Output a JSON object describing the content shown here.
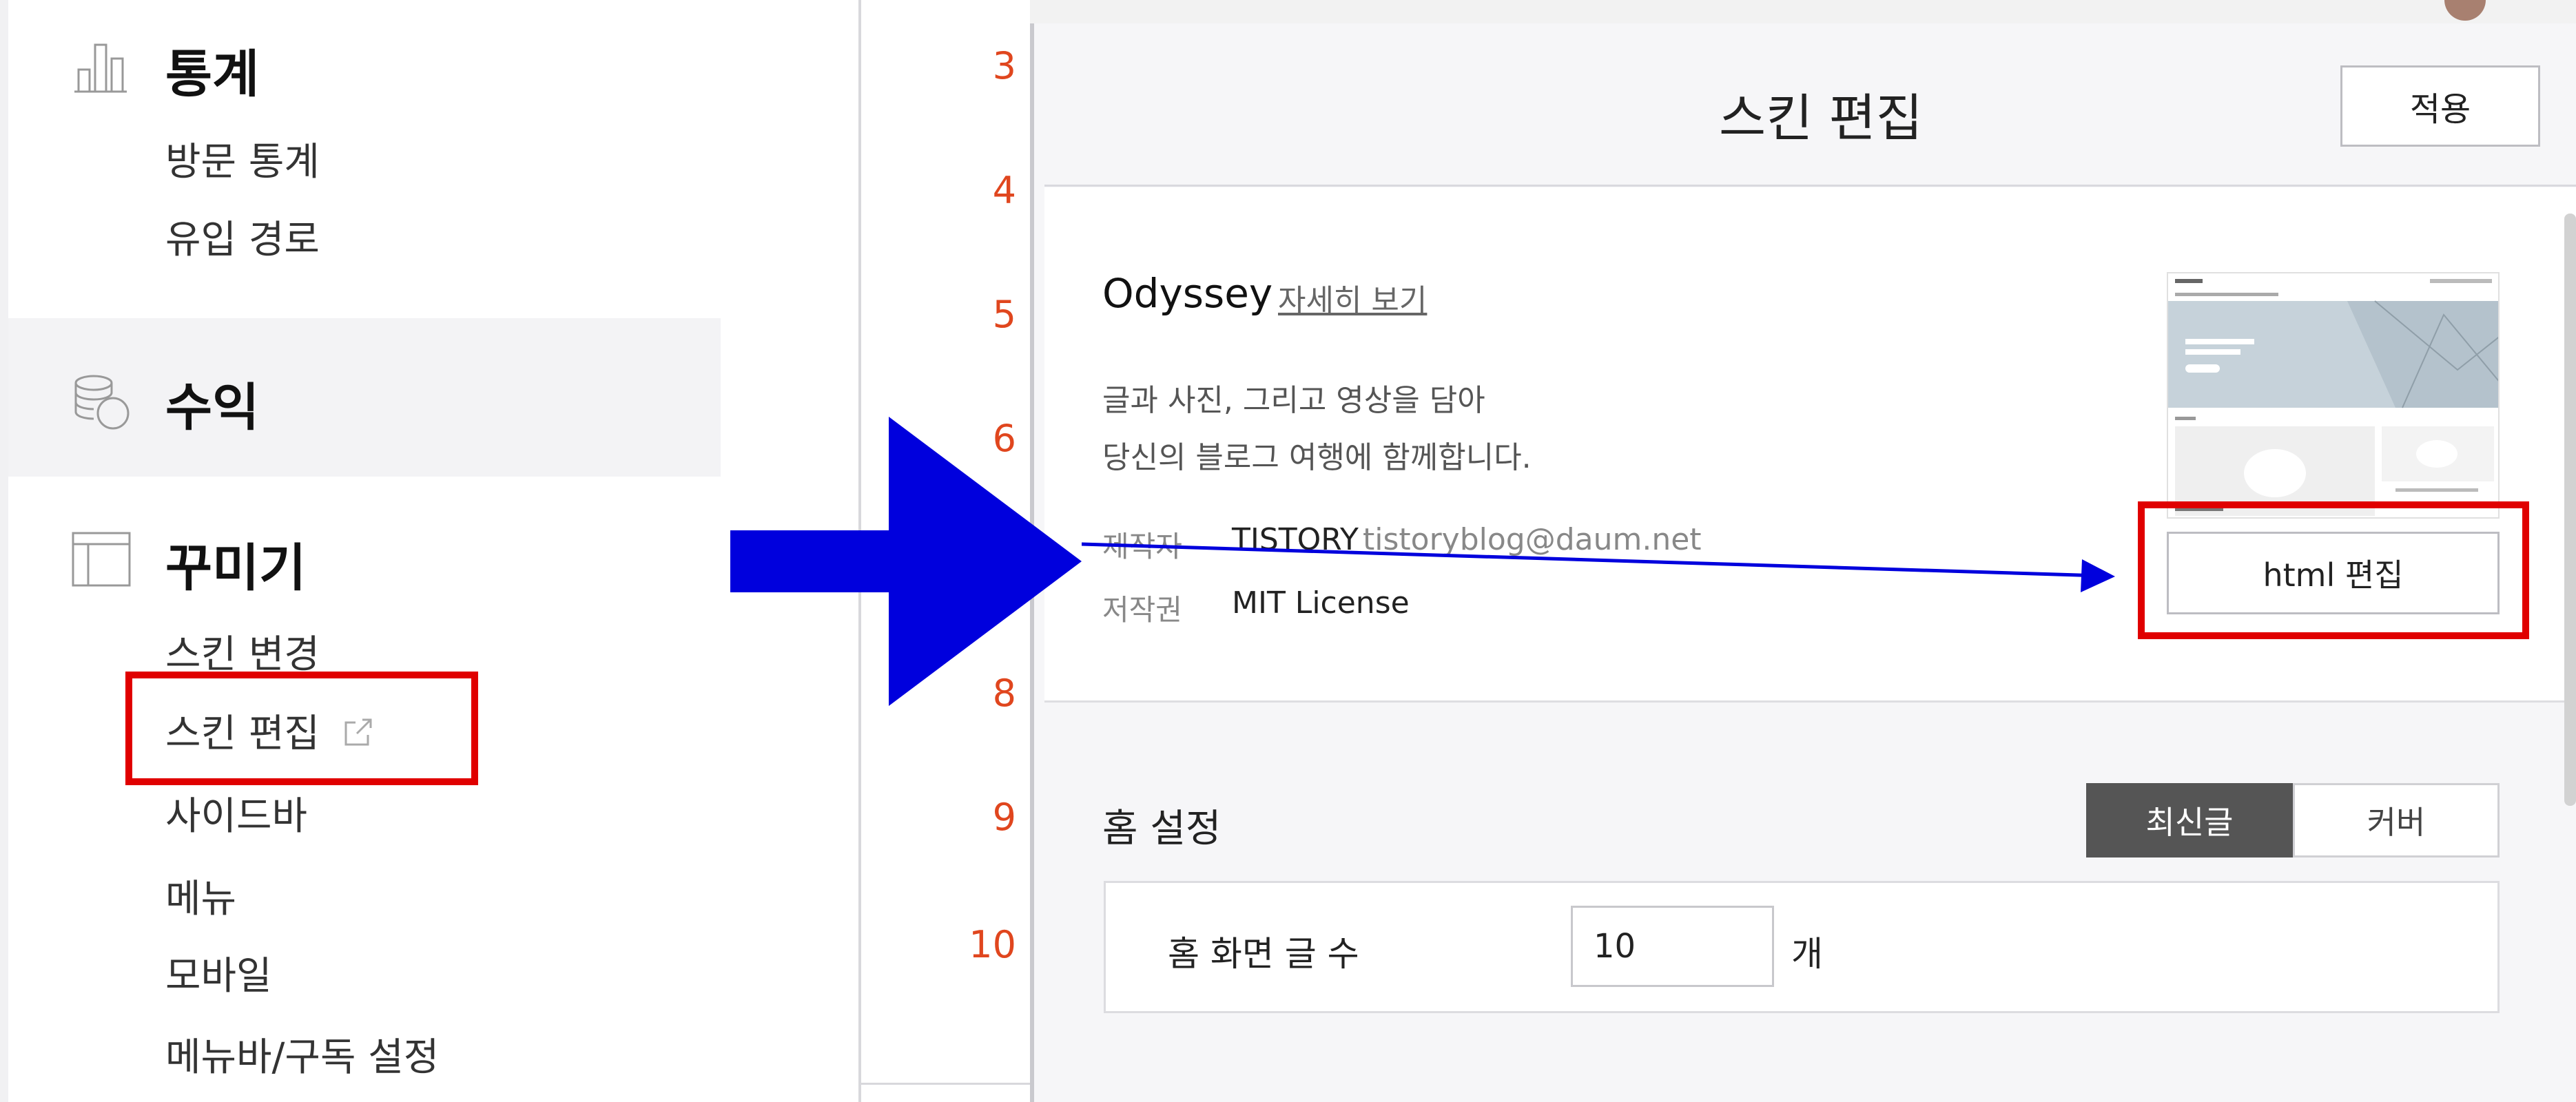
{
  "sidebar": {
    "stats": {
      "title": "통계",
      "items": [
        "방문 통계",
        "유입 경로"
      ]
    },
    "revenue": {
      "title": "수익"
    },
    "decorate": {
      "title": "꾸미기",
      "items": [
        "스킨 변경",
        "스킨 편집",
        "사이드바",
        "메뉴",
        "모바일",
        "메뉴바/구독 설정"
      ]
    }
  },
  "line_numbers": [
    "3",
    "4",
    "5",
    "6",
    "8",
    "9",
    "10"
  ],
  "header": {
    "title": "스킨 편집",
    "apply_label": "적용"
  },
  "skin": {
    "name": "Odyssey",
    "detail_link": "자세히 보기",
    "description_line1": "글과 사진, 그리고 영상을 담아",
    "description_line2": "당신의 블로그 여행에 함께합니다.",
    "author_label": "제작자",
    "author_name": "TISTORY",
    "author_email": "tistoryblog@daum.net",
    "license_label": "저작권",
    "license_value": "MIT License",
    "html_edit_label": "html 편집"
  },
  "home": {
    "title": "홈 설정",
    "segments": [
      "최신글",
      "커버"
    ],
    "selected_segment": "최신글",
    "post_count_label": "홈 화면 글 수",
    "post_count_value": "10",
    "post_count_unit": "개"
  },
  "colors": {
    "annotation_red": "#e00000",
    "annotation_blue": "#0000dd",
    "line_number": "#e0461e",
    "segment_active": "#555555"
  }
}
